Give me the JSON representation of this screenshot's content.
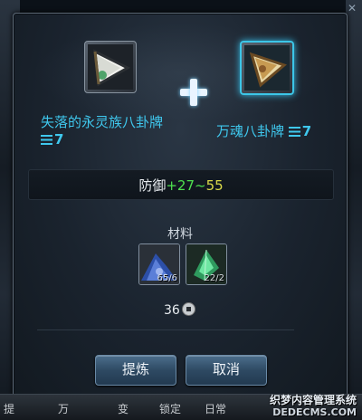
{
  "dialog": {
    "close_icon": "close-icon",
    "left_item": {
      "name": "失落的永灵族八卦牌",
      "tier": "7",
      "icon": "dark-flag-amulet-icon"
    },
    "right_item": {
      "name": "万魂八卦牌",
      "tier": "7",
      "icon": "gold-flag-amulet-icon",
      "accent_color": "#3cc6e8"
    },
    "plus_icon": "plus-icon",
    "stat": {
      "label": "防御",
      "min": "+27",
      "sep": "~",
      "max": "55"
    },
    "materials": {
      "title": "材料",
      "items": [
        {
          "icon": "blue-powder-icon",
          "count": "65/6"
        },
        {
          "icon": "green-crystal-icon",
          "count": "22/2"
        }
      ]
    },
    "cost": {
      "amount": "36",
      "icon": "silver-coin-icon"
    },
    "buttons": {
      "refine": "提炼",
      "cancel": "取消"
    }
  },
  "bottom_bar": {
    "tabs": [
      "提",
      "万",
      "变",
      "锁定",
      "日常"
    ]
  },
  "watermark": {
    "line1": "织梦内容管理系统",
    "line2": "DEDECMS.COM"
  },
  "colors": {
    "item_name": "#3fc8ee",
    "stat_green": "#4fe04f",
    "stat_yellow": "#d9d94a",
    "button": "#2e4a63"
  }
}
